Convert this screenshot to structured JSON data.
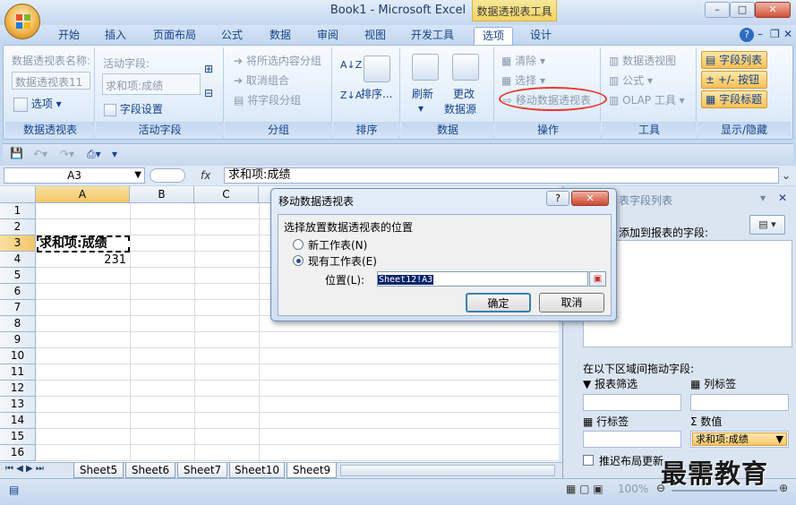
{
  "window": {
    "title": "Book1 - Microsoft Excel",
    "context_tab_title": "数据透视表工具",
    "help_icon": "?"
  },
  "tabs": [
    "开始",
    "插入",
    "页面布局",
    "公式",
    "数据",
    "审阅",
    "视图",
    "开发工具",
    "选项",
    "设计"
  ],
  "active_tab": "选项",
  "ribbon": {
    "pivot_group": {
      "name_label": "数据透视表名称:",
      "name_value": "数据透视表11",
      "options_label": "选项",
      "group_label": "数据透视表"
    },
    "active_field": {
      "label": "活动字段:",
      "value": "求和项:成绩",
      "settings_label": "字段设置",
      "group_label": "活动字段"
    },
    "group_group": {
      "items": [
        "将所选内容分组",
        "取消组合",
        "将字段分组"
      ],
      "group_label": "分组"
    },
    "sort_group": {
      "sort_label": "排序...",
      "group_label": "排序"
    },
    "data_group": {
      "refresh_label": "刷新",
      "change_source_line1": "更改",
      "change_source_line2": "数据源",
      "group_label": "数据"
    },
    "actions_group": {
      "items": [
        "清除",
        "选择",
        "移动数据透视表"
      ],
      "group_label": "操作"
    },
    "tools_group": {
      "items": [
        "数据透视图",
        "公式",
        "OLAP 工具"
      ],
      "group_label": "工具"
    },
    "show_hide_group": {
      "items": [
        "字段列表",
        "+/- 按钮",
        "字段标题"
      ],
      "group_label": "显示/隐藏"
    }
  },
  "formula_bar": {
    "name_box": "A3",
    "fx_label": "fx",
    "content": "求和项:成绩"
  },
  "grid": {
    "columns": [
      "A",
      "B",
      "C"
    ],
    "rows": [
      "1",
      "2",
      "3",
      "4",
      "5",
      "6",
      "7",
      "8",
      "9",
      "10",
      "11",
      "12",
      "13",
      "14",
      "15",
      "16"
    ],
    "cell_a3": "求和项:成绩",
    "cell_a4": "231"
  },
  "sheets": [
    "Sheet5",
    "Sheet6",
    "Sheet7",
    "Sheet10",
    "Sheet9"
  ],
  "task_pane": {
    "title": "表字段列表",
    "fields_label": "添加到报表的字段:",
    "drag_label": "在以下区域间拖动字段:",
    "report_filter": "报表筛选",
    "column_labels": "列标签",
    "row_labels": "行标签",
    "values": "数值",
    "values_item": "求和项:成绩",
    "defer_update": "推迟布局更新"
  },
  "dialog": {
    "title": "移动数据透视表",
    "section_label": "选择放置数据透视表的位置",
    "option_new": "新工作表(N)",
    "option_existing": "现有工作表(E)",
    "location_label": "位置(L):",
    "location_value": "Sheet12!A3",
    "ok_label": "确定",
    "cancel_label": "取消"
  },
  "status": {
    "zoom": "100%"
  },
  "watermark": "最需教育"
}
